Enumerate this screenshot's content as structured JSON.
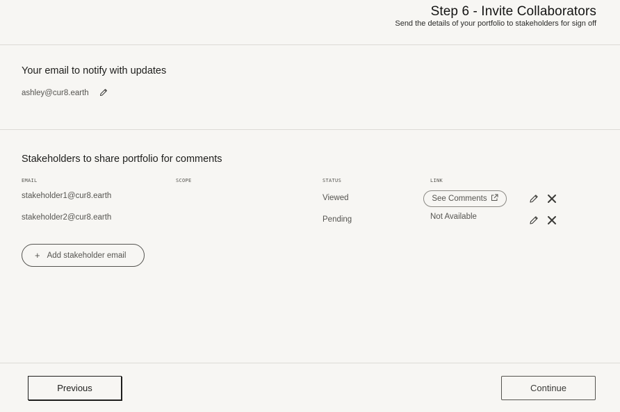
{
  "header": {
    "title": "Step 6 - Invite Collaborators",
    "subtitle": "Send the details of your portfolio to stakeholders for sign off"
  },
  "notify": {
    "title": "Your email to notify with updates",
    "email": "ashley@cur8.earth"
  },
  "stakeholders": {
    "title": "Stakeholders to share portfolio for comments",
    "columns": {
      "email": "EMAIL",
      "scope": "SCOPE",
      "status": "STATUS",
      "link": "LINK"
    },
    "rows": [
      {
        "email": "stakeholder1@cur8.earth",
        "status": "Viewed",
        "link": "See Comments"
      },
      {
        "email": "stakeholder2@cur8.earth",
        "status": "Pending",
        "link": "Not Available"
      }
    ],
    "add_label": "Add stakeholder email"
  },
  "footer": {
    "previous_label": "Previous",
    "continue_label": "Continue"
  },
  "icons": {
    "edit": "pencil-icon",
    "delete": "close-icon",
    "external": "external-link-icon",
    "add": "plus-icon"
  }
}
